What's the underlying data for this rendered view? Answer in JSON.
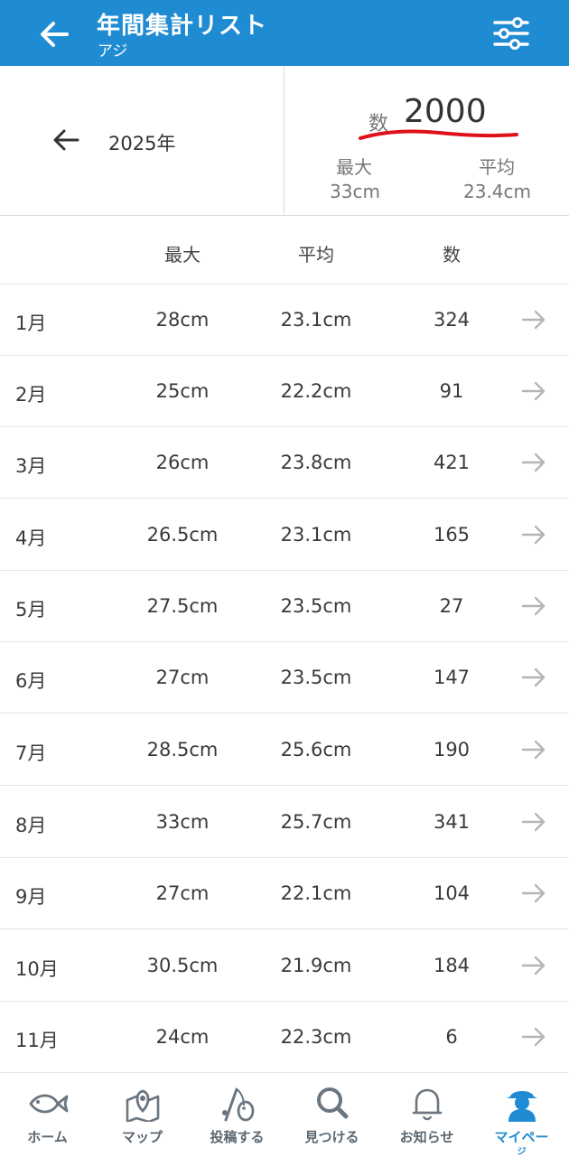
{
  "header": {
    "title": "年間集計リスト",
    "subtitle": "アジ",
    "icons": {
      "back": "arrow-left-icon",
      "filter": "sliders-icon"
    }
  },
  "summary": {
    "year": "2025年",
    "count_label": "数",
    "count_value": "2000",
    "max_label": "最大",
    "max_value": "33cm",
    "avg_label": "平均",
    "avg_value": "23.4cm",
    "underline_color": "#e0101a"
  },
  "table": {
    "headers": {
      "max": "最大",
      "avg": "平均",
      "count": "数"
    },
    "rows": [
      {
        "month": "1月",
        "max": "28cm",
        "avg": "23.1cm",
        "count": "324"
      },
      {
        "month": "2月",
        "max": "25cm",
        "avg": "22.2cm",
        "count": "91"
      },
      {
        "month": "3月",
        "max": "26cm",
        "avg": "23.8cm",
        "count": "421"
      },
      {
        "month": "4月",
        "max": "26.5cm",
        "avg": "23.1cm",
        "count": "165"
      },
      {
        "month": "5月",
        "max": "27.5cm",
        "avg": "23.5cm",
        "count": "27"
      },
      {
        "month": "6月",
        "max": "27cm",
        "avg": "23.5cm",
        "count": "147"
      },
      {
        "month": "7月",
        "max": "28.5cm",
        "avg": "25.6cm",
        "count": "190"
      },
      {
        "month": "8月",
        "max": "33cm",
        "avg": "25.7cm",
        "count": "341"
      },
      {
        "month": "9月",
        "max": "27cm",
        "avg": "22.1cm",
        "count": "104"
      },
      {
        "month": "10月",
        "max": "30.5cm",
        "avg": "21.9cm",
        "count": "184"
      },
      {
        "month": "11月",
        "max": "24cm",
        "avg": "22.3cm",
        "count": "6"
      }
    ]
  },
  "nav": {
    "items": [
      {
        "label": "ホーム",
        "icon": "fish-icon"
      },
      {
        "label": "マップ",
        "icon": "map-pin-icon"
      },
      {
        "label": "投稿する",
        "icon": "fishing-rod-icon"
      },
      {
        "label": "見つける",
        "icon": "search-icon"
      },
      {
        "label": "お知らせ",
        "icon": "bell-icon"
      },
      {
        "label": "マイペー",
        "sub": "ジ",
        "icon": "user-cap-icon",
        "active": true
      }
    ],
    "colors": {
      "active": "#1f8bd2",
      "inactive": "#5a6670"
    }
  },
  "colors": {
    "brand": "#1f8bd2"
  }
}
